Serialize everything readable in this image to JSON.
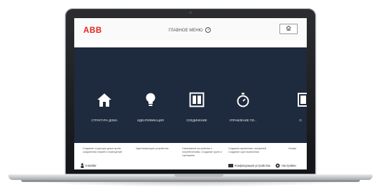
{
  "header": {
    "logo_text": "ABB",
    "title": "ГЛАВНОЕ МЕНЮ",
    "help_glyph": "?"
  },
  "tiles": [
    {
      "label": "СТРУКТУРА ДОМА",
      "icon": "house-icon"
    },
    {
      "label": "ИДЕНТИФИКАЦИЯ",
      "icon": "bulb-icon"
    },
    {
      "label": "СОЕДИНЕНИЕ",
      "icon": "switch-panel-icon"
    },
    {
      "label": "УПРАВЛЕНИЕ ПО...",
      "icon": "timer-icon"
    },
    {
      "label": "О",
      "icon": "device-icon"
    }
  ],
  "descriptions": [
    "Создание структуры дома путем соединения этажей и помещений",
    "Идентификация устройства",
    "Связывание устройства с потребителями. Создание групп и сценариев",
    "Создание временных профилей. Создание сцен включения",
    "Конфи"
  ],
  "footer": {
    "user_label": "Installer",
    "config_label": "Конфигурация устройства",
    "settings_label": "Настройки"
  },
  "colors": {
    "brand_red": "#e2231a",
    "panel_bg": "#1e2a3d",
    "tile_text": "#e6e9ee"
  }
}
